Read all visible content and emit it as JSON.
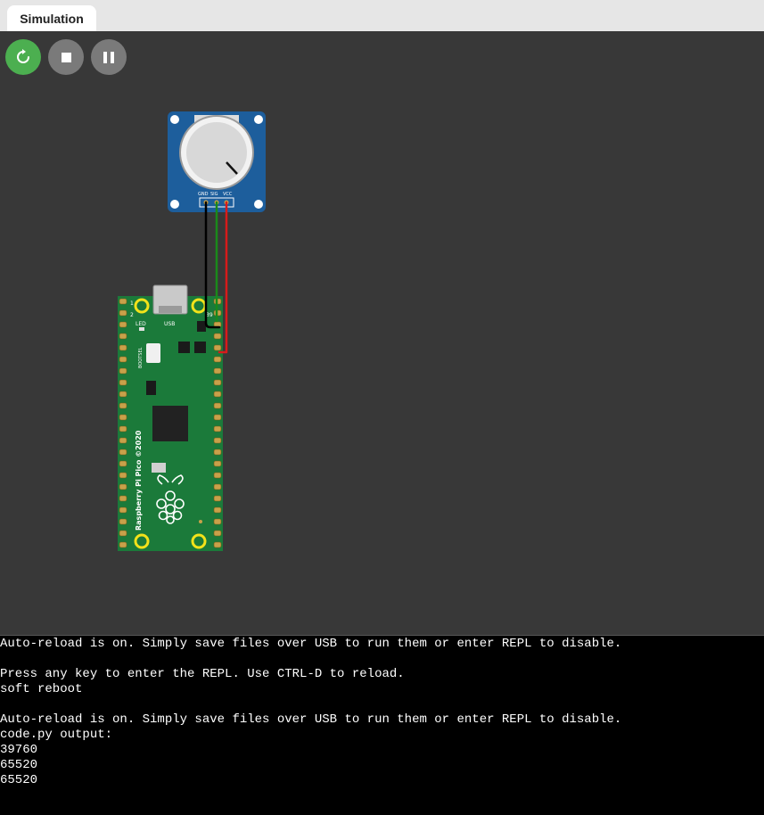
{
  "tab": {
    "label": "Simulation"
  },
  "controls": {
    "restart": {
      "icon": "restart-icon"
    },
    "stop": {
      "icon": "stop-icon"
    },
    "pause": {
      "icon": "pause-icon"
    }
  },
  "colors": {
    "canvas": "#383838",
    "restart": "#4caf50",
    "control": "#7a7a7a",
    "pcb": "#1b7a3a",
    "pot_board": "#1d5e9c",
    "wire_gnd": "#000000",
    "wire_sig": "#1a8a1a",
    "wire_vcc": "#d81b1b"
  },
  "potentiometer": {
    "pins": [
      "GND",
      "SIG",
      "VCC"
    ]
  },
  "pico": {
    "labels": {
      "led": "LED",
      "usb": "USB",
      "bootsel": "BOOTSEL",
      "brand": "Raspberry Pi Pico ©2020",
      "pin1": "1",
      "pin2": "2",
      "pin39": "39"
    }
  },
  "console": {
    "lines": [
      "Auto-reload is on. Simply save files over USB to run them or enter REPL to disable.",
      "",
      "Press any key to enter the REPL. Use CTRL-D to reload.",
      "soft reboot",
      "",
      "Auto-reload is on. Simply save files over USB to run them or enter REPL to disable.",
      "code.py output:",
      "39760",
      "65520",
      "65520"
    ]
  }
}
